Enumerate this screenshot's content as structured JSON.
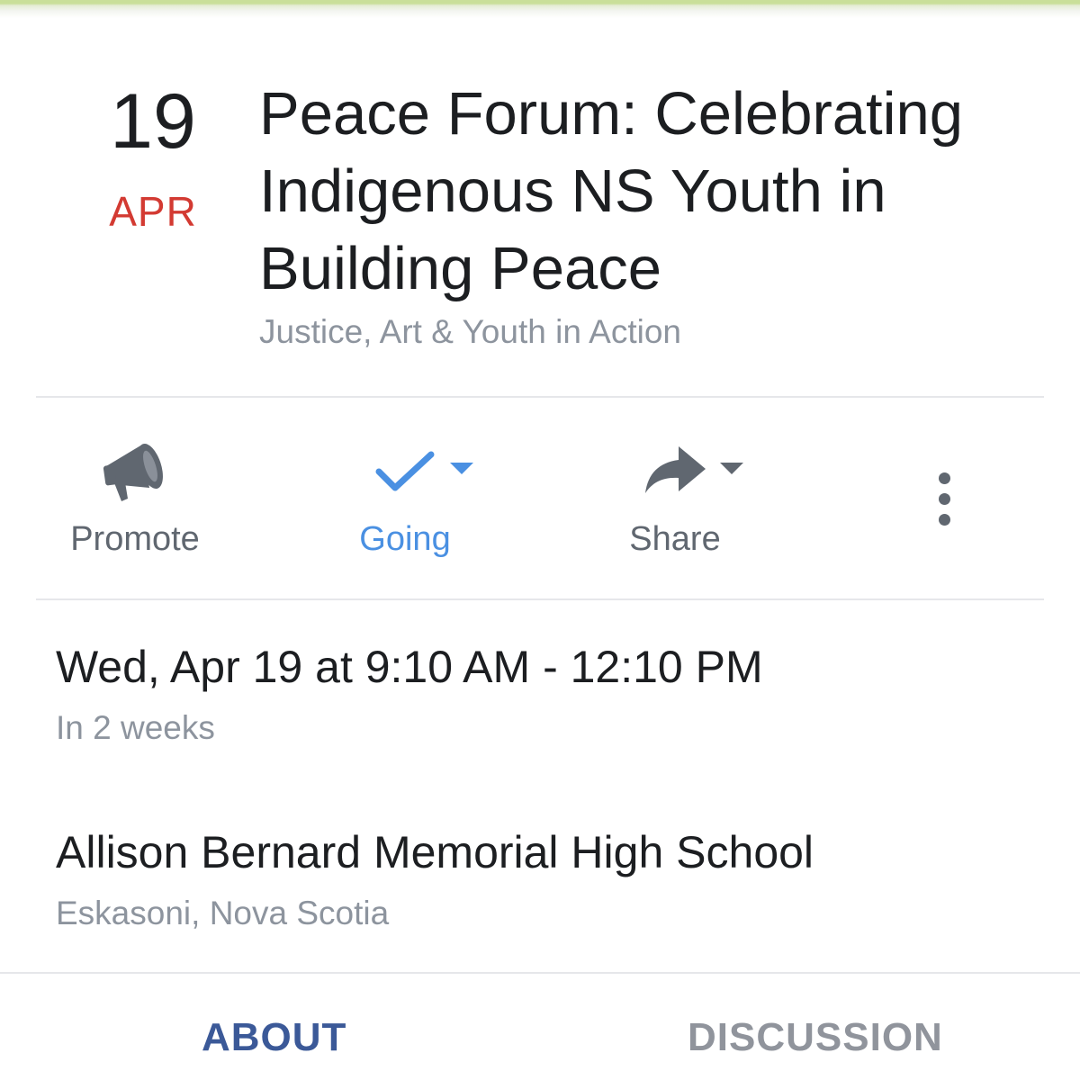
{
  "event": {
    "day": "19",
    "month": "APR",
    "title": "Peace Forum: Celebrating Indigenous NS Youth in Building Peace",
    "host": "Justice, Art & Youth in Action"
  },
  "actions": {
    "promote": {
      "label": "Promote",
      "icon": "megaphone-icon"
    },
    "going": {
      "label": "Going",
      "icon": "checkmark-icon"
    },
    "share": {
      "label": "Share",
      "icon": "share-arrow-icon"
    },
    "more": {
      "icon": "more-vertical-icon"
    }
  },
  "details": {
    "time": "Wed, Apr 19 at 9:10 AM - 12:10 PM",
    "time_relative": "In 2 weeks",
    "venue": "Allison Bernard Memorial High School",
    "location": "Eskasoni, Nova Scotia"
  },
  "tabs": {
    "about": "ABOUT",
    "discussion": "DISCUSSION"
  },
  "colors": {
    "month_red": "#d33a32",
    "going_blue": "#4a90e2",
    "tab_active": "#3b5998",
    "secondary_text": "#8d949e",
    "icon_gray": "#606770"
  }
}
